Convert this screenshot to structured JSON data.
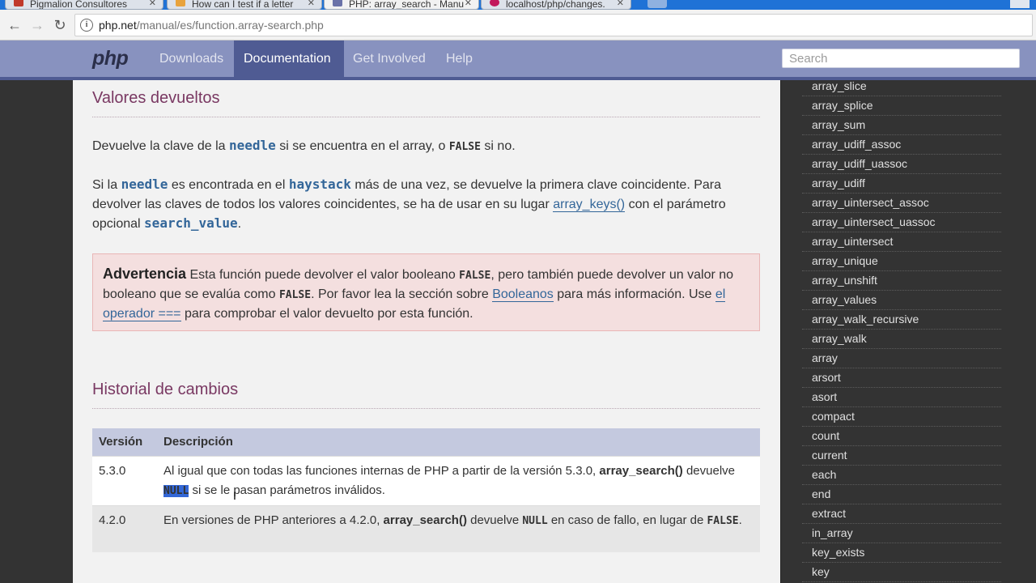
{
  "browser": {
    "tabs": [
      {
        "title": "Pigmalion Consultores"
      },
      {
        "title": "How can I test if a letter"
      },
      {
        "title": "PHP: array_search - Manu"
      },
      {
        "title": "localhost/php/changes."
      }
    ],
    "url_host": "php.net",
    "url_path": "/manual/es/function.array-search.php"
  },
  "nav": {
    "logo": "php",
    "links": [
      "Downloads",
      "Documentation",
      "Get Involved",
      "Help"
    ],
    "active": "Documentation",
    "search_placeholder": "Search"
  },
  "returns": {
    "heading": "Valores devueltos",
    "p1": {
      "a": "Devuelve la clave de la ",
      "needle": "needle",
      "b": " si se encuentra en el array, o ",
      "false": "FALSE",
      "c": " si no."
    },
    "p2": {
      "a": "Si la ",
      "needle": "needle",
      "b": " es encontrada en el ",
      "haystack": "haystack",
      "c": " más de una vez, se devuelve la primera clave coincidente. Para devolver las claves de todos los valores coincidentes, se ha de usar en su lugar ",
      "link": "array_keys()",
      "d": " con el parámetro opcional ",
      "param": "search_value",
      "e": "."
    }
  },
  "warning": {
    "title": "Advertencia",
    "a": " Esta función puede devolver el valor booleano ",
    "false1": "FALSE",
    "b": ", pero también puede devolver un valor no booleano que se evalúa como ",
    "false2": "FALSE",
    "c": ". Por favor lea la sección sobre ",
    "link1": "Booleanos",
    "d": " para más información. Use ",
    "link2": "el operador ===",
    "e": " para comprobar el valor devuelto por esta función."
  },
  "changelog": {
    "heading": "Historial de cambios",
    "col_version": "Versión",
    "col_desc": "Descripción",
    "rows": [
      {
        "version": "5.3.0",
        "a": "Al igual que con todas las funciones internas de PHP a partir de la versión 5.3.0, ",
        "fn": "array_search()",
        "b": " devuelve ",
        "null": "NULL",
        "c": " si se le pasan parámetros inválidos."
      },
      {
        "version": "4.2.0",
        "a": "En versiones de PHP anteriores a 4.2.0, ",
        "fn": "array_search()",
        "b": " devuelve ",
        "null": "NULL",
        "c": " en caso de fallo, en lugar de ",
        "false": "FALSE",
        "d": "."
      }
    ]
  },
  "sidebar": {
    "items": [
      "array_slice",
      "array_splice",
      "array_sum",
      "array_udiff_assoc",
      "array_udiff_uassoc",
      "array_udiff",
      "array_uintersect_assoc",
      "array_uintersect_uassoc",
      "array_uintersect",
      "array_unique",
      "array_unshift",
      "array_values",
      "array_walk_recursive",
      "array_walk",
      "array",
      "arsort",
      "asort",
      "compact",
      "count",
      "current",
      "each",
      "end",
      "extract",
      "in_array",
      "key_exists",
      "key"
    ]
  },
  "colors": {
    "nav": "#8892bf",
    "nav_active": "#4f5b93",
    "heading": "#793862",
    "link": "#336699",
    "warning_bg": "#f4dfdf"
  }
}
